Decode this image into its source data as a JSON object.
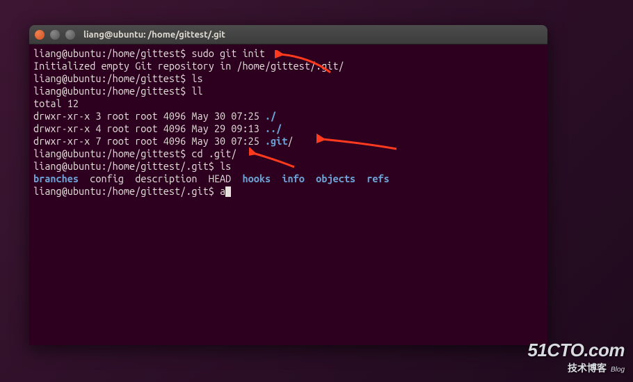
{
  "window": {
    "title": "liang@ubuntu: /home/gittest/.git"
  },
  "terminal": {
    "lines": [
      {
        "prompt": "liang@ubuntu:/home/gittest$ ",
        "cmd": "sudo git init"
      },
      {
        "text": "Initialized empty Git repository in /home/gittest/.git/"
      },
      {
        "prompt": "liang@ubuntu:/home/gittest$ ",
        "cmd": "ls"
      },
      {
        "prompt": "liang@ubuntu:/home/gittest$ ",
        "cmd": "ll"
      },
      {
        "text": "total 12"
      },
      {
        "perm": "drwxr-xr-x 3 root root 4096 May 30 07:25 ",
        "name": "./",
        "nclass": "dir-blue"
      },
      {
        "perm": "drwxr-xr-x 4 root root 4096 May 29 09:13 ",
        "name": "../",
        "nclass": "dir-blue"
      },
      {
        "perm": "drwxr-xr-x 7 root root 4096 May 30 07:25 ",
        "name_pre": ".git",
        "name_post": "/",
        "nclass": "dir-blue"
      },
      {
        "prompt": "liang@ubuntu:/home/gittest$ ",
        "cmd": "cd .git/"
      },
      {
        "prompt": "liang@ubuntu:/home/gittest/.git$ ",
        "cmd": "ls"
      }
    ],
    "ls_out": {
      "items": [
        {
          "name": "branches",
          "class": "dir-blue"
        },
        {
          "name": "config",
          "class": ""
        },
        {
          "name": "description",
          "class": ""
        },
        {
          "name": "HEAD",
          "class": ""
        },
        {
          "name": "hooks",
          "class": "dir-blue"
        },
        {
          "name": "info",
          "class": "dir-blue"
        },
        {
          "name": "objects",
          "class": "dir-blue"
        },
        {
          "name": "refs",
          "class": "dir-blue"
        }
      ]
    },
    "current": {
      "prompt": "liang@ubuntu:/home/gittest/.git$ ",
      "input": "a"
    }
  },
  "annotations": {
    "arrows": [
      {
        "id": "arrow-to-init",
        "target": "sudo git init"
      },
      {
        "id": "arrow-to-dotgit",
        "target": ".git/"
      },
      {
        "id": "arrow-to-cd",
        "target": "cd .git/"
      }
    ],
    "color": "#ff3a1f"
  },
  "watermark": {
    "line1": "51CTO.com",
    "line2": "技术博客",
    "line3": "Blog"
  }
}
